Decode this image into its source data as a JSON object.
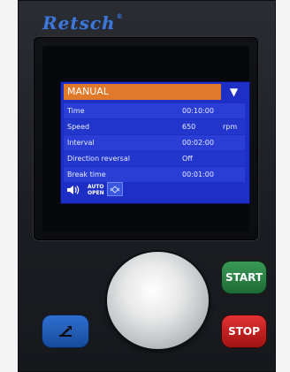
{
  "brand": {
    "name": "Retsch",
    "mark": "®"
  },
  "screen": {
    "mode_label": "MANUAL",
    "dropdown_icon": "▼",
    "rows": [
      {
        "label": "Time",
        "value": "00:10:00",
        "unit": ""
      },
      {
        "label": "Speed",
        "value": "650",
        "unit": "rpm"
      },
      {
        "label": "Interval",
        "value": "00:02:00",
        "unit": ""
      },
      {
        "label": "Direction reversal",
        "value": "Off",
        "unit": ""
      },
      {
        "label": "Break time",
        "value": "00:01:00",
        "unit": ""
      }
    ],
    "status_icons": {
      "sound": "speaker-icon",
      "auto_open_line1": "AUTO",
      "auto_open_line2": "OPEN",
      "rotation": "rotation-mode-icon"
    }
  },
  "controls": {
    "start_label": "START",
    "stop_label": "STOP",
    "open_icon": "open-lid-icon"
  },
  "colors": {
    "screen_bg": "#1d2fc4",
    "mode_bar": "#e07a2a",
    "start": "#2e8a4a",
    "stop": "#d62020",
    "open": "#2560c0",
    "brand": "#3f77d8"
  }
}
